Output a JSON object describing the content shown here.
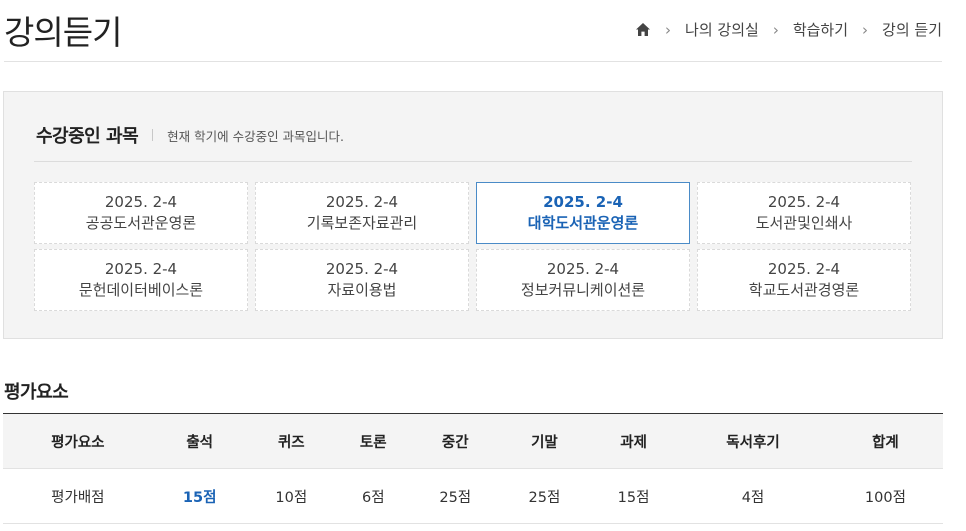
{
  "page": {
    "title": "강의듣기"
  },
  "breadcrumb": {
    "home_icon": "home-icon",
    "items": [
      "나의 강의실",
      "학습하기",
      "강의 듣기"
    ]
  },
  "courses": {
    "heading": "수강중인 과목",
    "description": "현재 학기에 수강중인 과목입니다.",
    "items": [
      {
        "term": "2025. 2-4",
        "name": "공공도서관운영론",
        "active": false
      },
      {
        "term": "2025. 2-4",
        "name": "기록보존자료관리",
        "active": false
      },
      {
        "term": "2025. 2-4",
        "name": "대학도서관운영론",
        "active": true
      },
      {
        "term": "2025. 2-4",
        "name": "도서관및인쇄사",
        "active": false
      },
      {
        "term": "2025. 2-4",
        "name": "문헌데이터베이스론",
        "active": false
      },
      {
        "term": "2025. 2-4",
        "name": "자료이용법",
        "active": false
      },
      {
        "term": "2025. 2-4",
        "name": "정보커뮤니케이션론",
        "active": false
      },
      {
        "term": "2025. 2-4",
        "name": "학교도서관경영론",
        "active": false
      }
    ],
    "active_color": "#1a63b5"
  },
  "evaluation": {
    "title": "평가요소",
    "headers": [
      "평가요소",
      "출석",
      "퀴즈",
      "토론",
      "중간",
      "기말",
      "과제",
      "독서후기",
      "합계"
    ],
    "row": [
      "평가배점",
      "15점",
      "10점",
      "6점",
      "25점",
      "25점",
      "15점",
      "4점",
      "100점"
    ]
  }
}
